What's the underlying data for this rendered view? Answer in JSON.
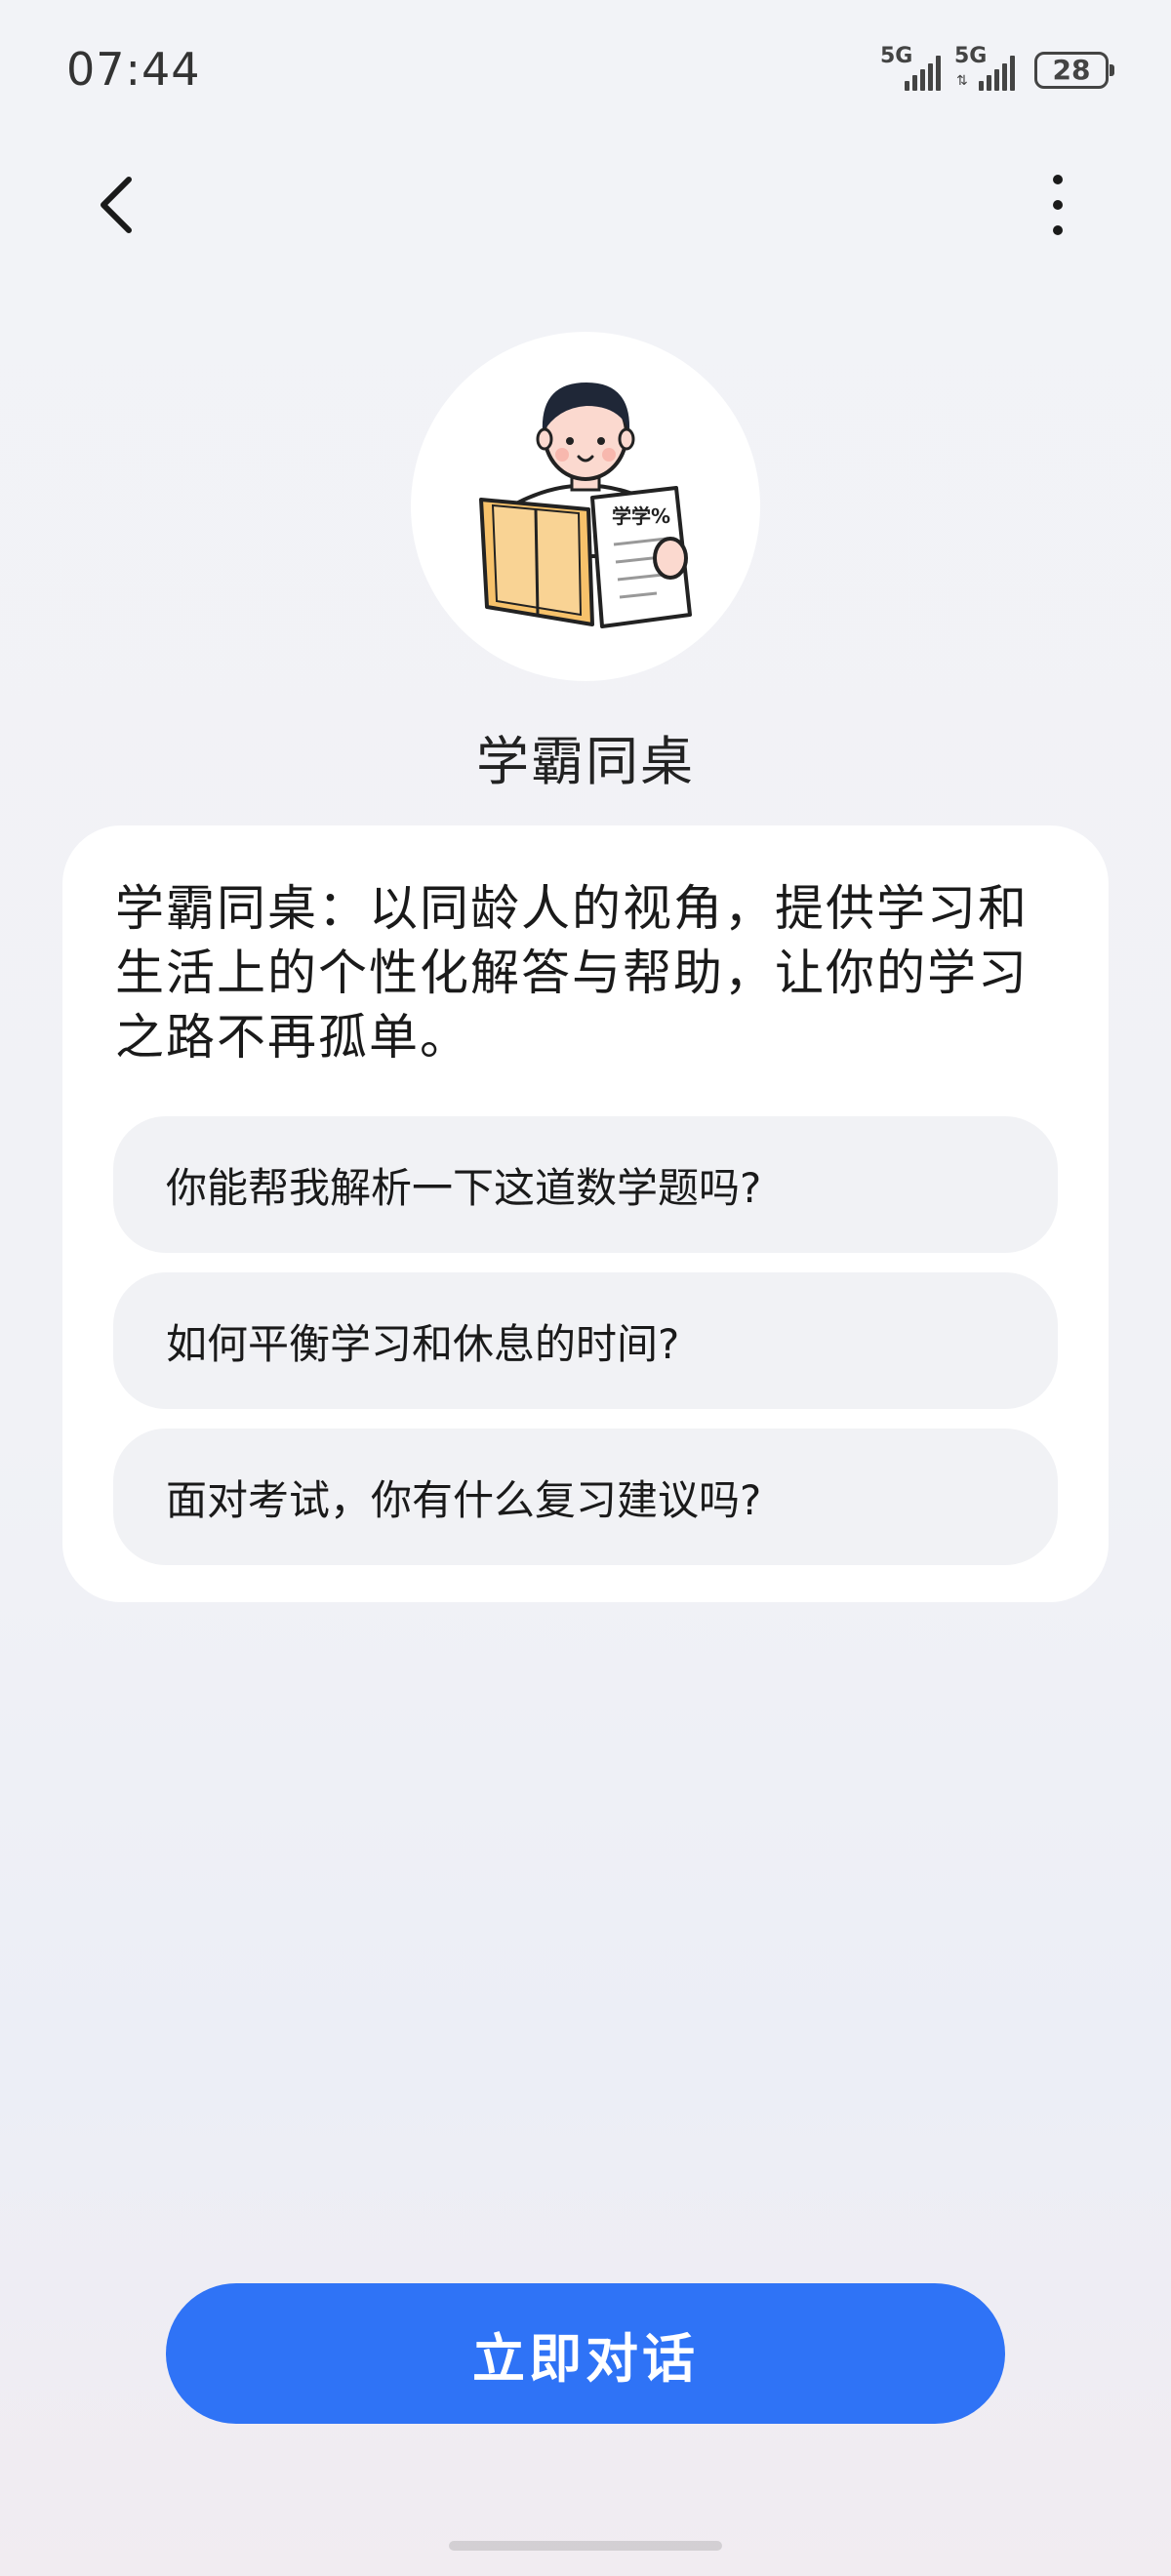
{
  "status_bar": {
    "time": "07:44",
    "signal_1_label": "5G",
    "signal_2_label": "5G",
    "signal_2_arrows": "⇅",
    "battery": "28"
  },
  "nav": {
    "back_icon": "chevron-left-icon",
    "more_icon": "more-vertical-icon"
  },
  "bot": {
    "name": "学霸同桌",
    "avatar_paper_text": "学学%",
    "description": "学霸同桌：以同龄人的视角，提供学习和生活上的个性化解答与帮助，让你的学习之路不再孤单。"
  },
  "suggestions": [
    {
      "text": "你能帮我解析一下这道数学题吗?"
    },
    {
      "text": "如何平衡学习和休息的时间?"
    },
    {
      "text": "面对考试，你有什么复习建议吗?"
    }
  ],
  "cta": {
    "label": "立即对话",
    "color": "#2f73f6"
  }
}
